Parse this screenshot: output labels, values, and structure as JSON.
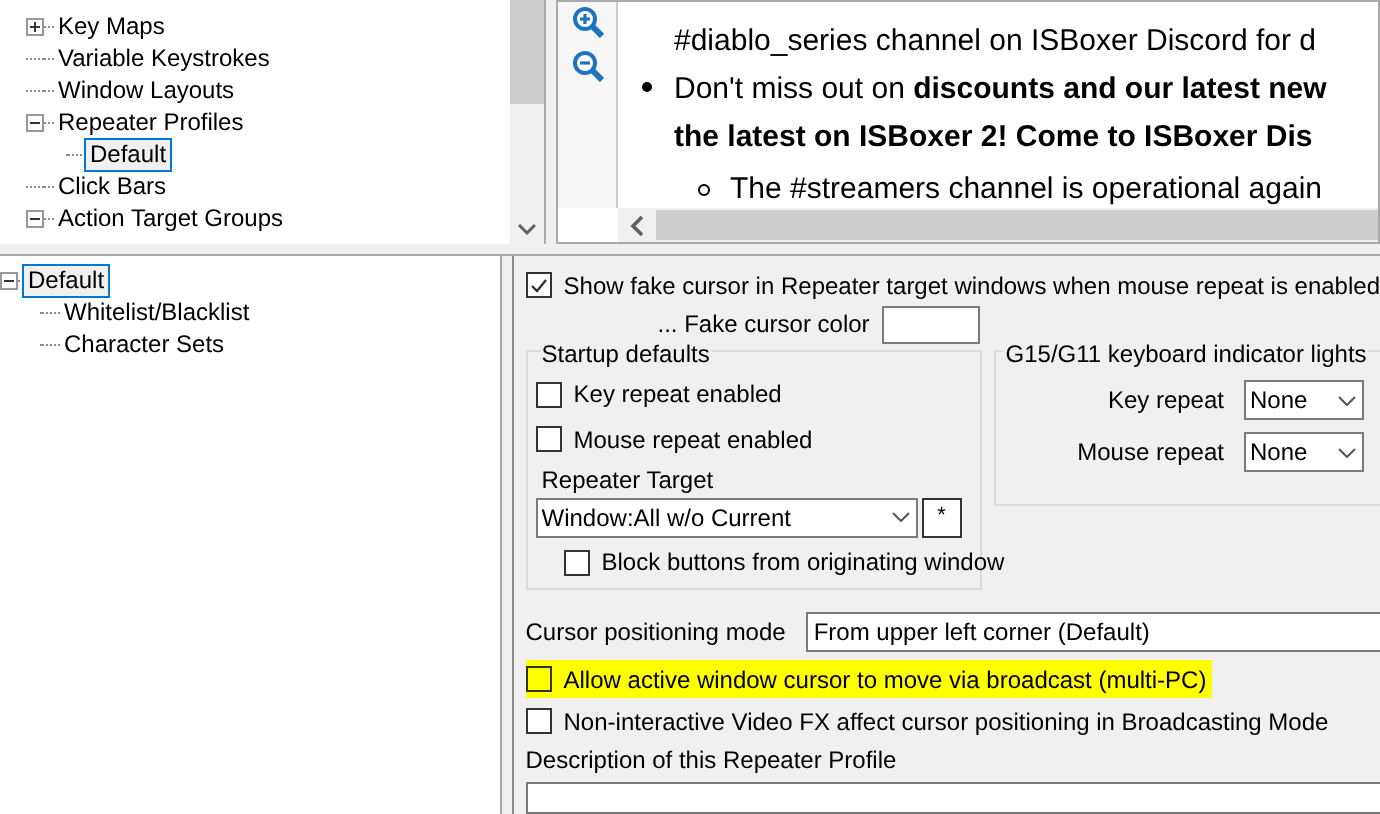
{
  "nav_tree": {
    "items": [
      {
        "label": "Key Maps",
        "expanded": false,
        "selected": false
      },
      {
        "label": "Variable Keystrokes",
        "selected": false
      },
      {
        "label": "Window Layouts",
        "selected": false
      },
      {
        "label": "Repeater Profiles",
        "expanded": true,
        "selected": false,
        "children": [
          {
            "label": "Default",
            "selected": true
          }
        ]
      },
      {
        "label": "Click Bars",
        "selected": false
      },
      {
        "label": "Action Target Groups",
        "expanded": true,
        "selected": false
      }
    ]
  },
  "news": {
    "bullets": [
      {
        "text": "#diablo_series channel on ISBoxer Discord for d",
        "continued": true
      },
      {
        "text": "Don't miss out on **discounts and our latest new**",
        "continued": false
      },
      {
        "text": "**the latest on ISBoxer 2! Come to ISBoxer Dis**",
        "continued": true
      }
    ],
    "sub_bullets": [
      "The #streamers channel is operational again"
    ]
  },
  "profile_tree": {
    "items": [
      {
        "label": "Default",
        "selected": true,
        "expanded": true,
        "children": [
          {
            "label": "Whitelist/Blacklist",
            "selected": false
          },
          {
            "label": "Character Sets",
            "selected": false
          }
        ]
      }
    ]
  },
  "settings": {
    "show_fake_cursor": {
      "label": "Show fake cursor in Repeater target windows when mouse repeat is enabled",
      "checked": true
    },
    "fake_cursor_color": {
      "label": "... Fake cursor color",
      "color": "#ffffff"
    },
    "startup_defaults": {
      "title": "Startup defaults",
      "options": [
        {
          "label": "Key repeat enabled",
          "checked": false
        },
        {
          "label": "Mouse repeat enabled",
          "checked": false
        }
      ],
      "repeater_target": {
        "label": "Repeater Target",
        "value": "Window:All w/o Current",
        "button": "*"
      },
      "block_buttons": {
        "label": "Block buttons from originating window",
        "checked": false
      }
    },
    "g15": {
      "title": "G15/G11 keyboard indicator lights",
      "rows": [
        {
          "label": "Key repeat",
          "value": "None"
        },
        {
          "label": "Mouse repeat",
          "value": "None"
        }
      ]
    },
    "cursor_positioning": {
      "label": "Cursor positioning mode",
      "value": "From upper left corner (Default)"
    },
    "options": [
      {
        "label": "Allow active window cursor to move via broadcast (multi-PC)",
        "checked": false,
        "highlighted": true
      },
      {
        "label": "Non-interactive Video FX affect cursor positioning in Broadcasting Mode",
        "checked": false,
        "highlighted": false
      }
    ],
    "description_label": "Description of this Repeater Profile"
  }
}
